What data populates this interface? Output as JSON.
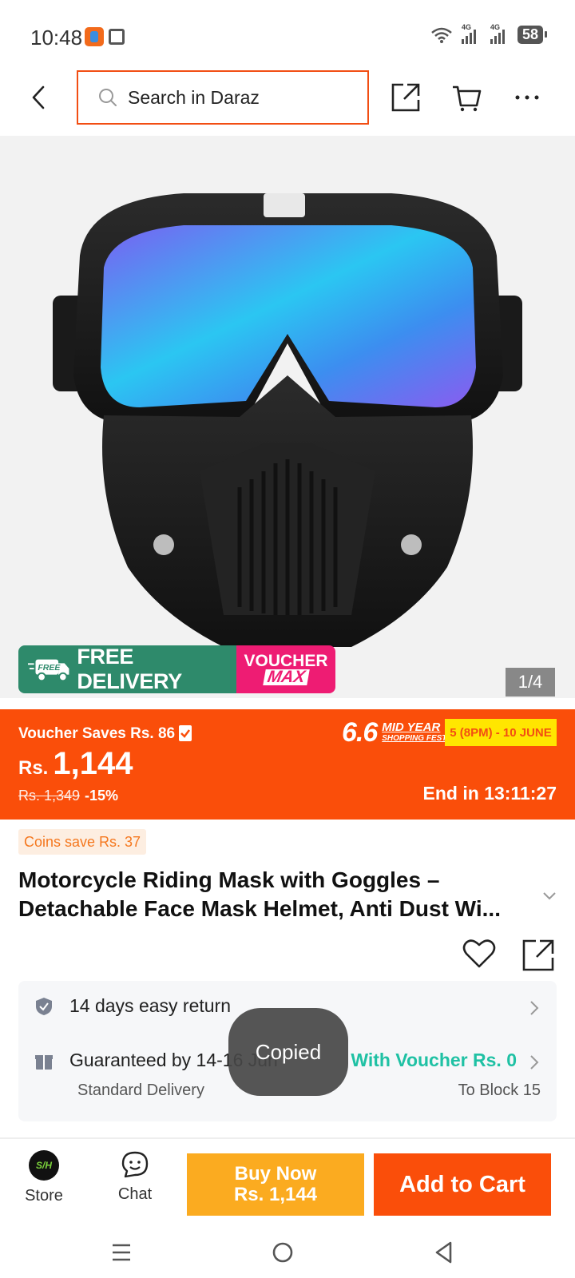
{
  "status_bar": {
    "time": "10:48",
    "network_1": "4G",
    "network_2": "4G",
    "battery": "58"
  },
  "header": {
    "search_placeholder": "Search in Daraz"
  },
  "gallery": {
    "image_description": "",
    "free_delivery": "FREE DELIVERY",
    "free_tag": "FREE",
    "voucher_line1": "VOUCHER",
    "voucher_line2": "MAX",
    "page_indicator": "1/4"
  },
  "price": {
    "voucher_saves": "Voucher Saves Rs. 86",
    "currency": "Rs.",
    "current": "1,144",
    "original": "Rs. 1,349",
    "discount": "-15%",
    "event_number": "6.6",
    "event_name": "MID YEAR",
    "event_sub": "SHOPPING FEST!",
    "event_date": "5 (8PM) - 10 JUNE",
    "countdown": "End in 13:11:27"
  },
  "product": {
    "coins_save": "Coins save Rs. 37",
    "title": "Motorcycle Riding Mask with Goggles – Detachable Face Mask Helmet, Anti Dust Wi..."
  },
  "service": {
    "return_text": "14 days easy return",
    "delivery_text": "Guaranteed by 14-16 Jun",
    "delivery_sub": "Standard Delivery",
    "voucher_text": "With Voucher Rs. 0",
    "destination": "To Block 15"
  },
  "toast": {
    "text": "Copied"
  },
  "bottom_bar": {
    "store_label": "Store",
    "store_logo_text": "S/H",
    "chat_label": "Chat",
    "buy_now_label": "Buy Now",
    "buy_now_price": "Rs. 1,144",
    "add_to_cart_label": "Add to Cart"
  },
  "colors": {
    "brand_orange": "#fa4e0a",
    "buy_now": "#fbab20",
    "free_delivery_green": "#2e8a6b",
    "voucher_pink": "#ee1c73",
    "voucher_teal": "#1fc1a4"
  }
}
